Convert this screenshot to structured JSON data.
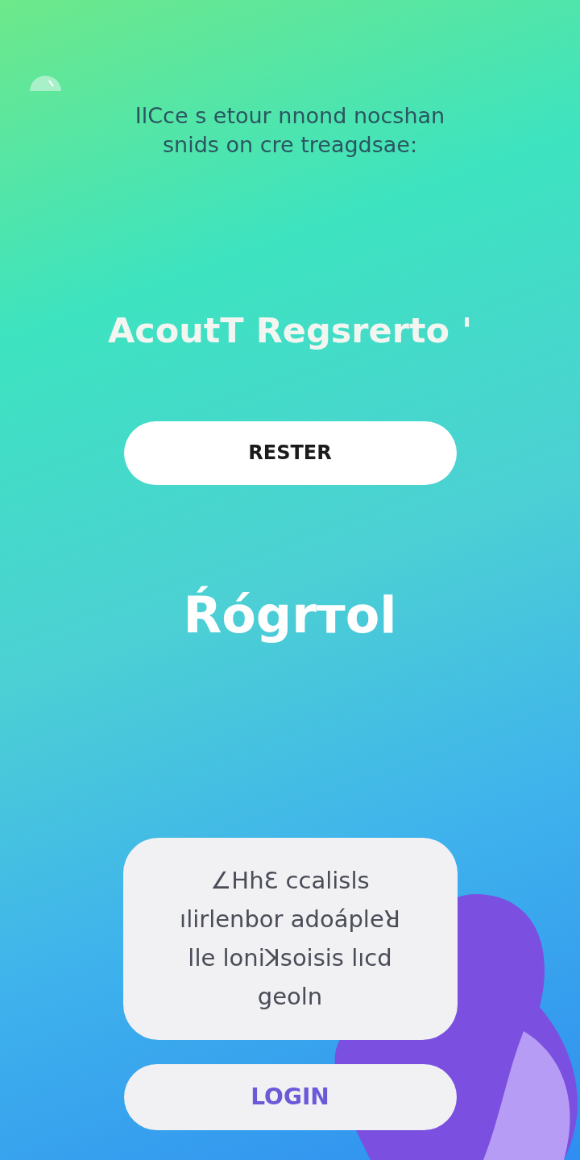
{
  "subtitle_lines": [
    "IlCce s etour nnond nocshan",
    "snids on cre treagdsae:"
  ],
  "title": "AcoutT Regsrerto '",
  "register_button": "RESTER",
  "logo_text": "Ŕógrтol",
  "info_card_lines": [
    "∠HhƐ ᴄcalisls",
    "ılirlenbor adoápleꓤ",
    "lle loniꓘsoisis lıcd",
    "geoln"
  ],
  "login_button": "LOGIN"
}
